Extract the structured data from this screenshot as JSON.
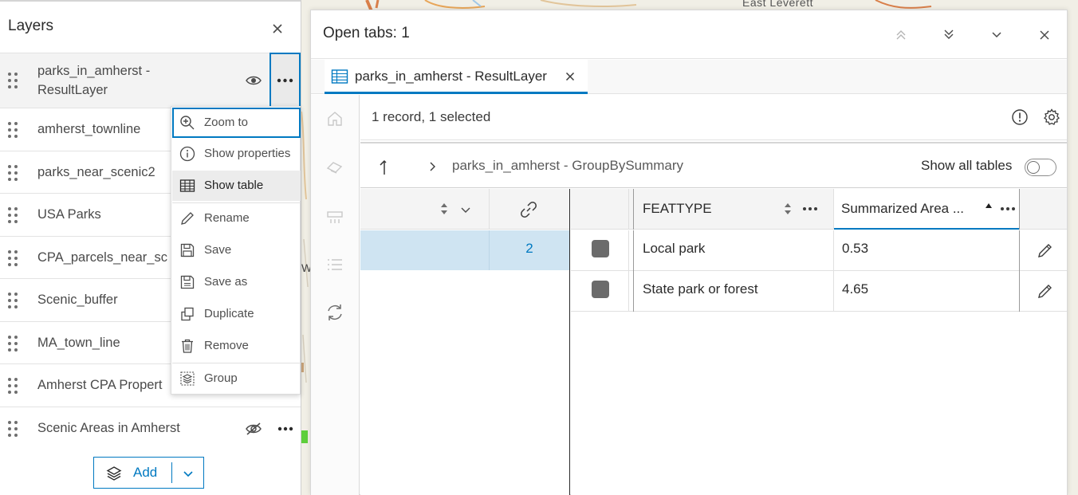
{
  "layers_panel": {
    "title": "Layers",
    "items": [
      {
        "label_line1": "parks_in_amherst -",
        "label_line2": "ResultLayer",
        "visible": true
      },
      {
        "label": "amherst_townline"
      },
      {
        "label": "parks_near_scenic2"
      },
      {
        "label": "USA Parks"
      },
      {
        "label": "CPA_parcels_near_sc"
      },
      {
        "label": "Scenic_buffer"
      },
      {
        "label": "MA_town_line"
      },
      {
        "label": "Amherst CPA Propert"
      },
      {
        "label": "Scenic Areas in Amherst",
        "visible": false
      }
    ],
    "add_label": "Add"
  },
  "context_menu": {
    "items": [
      {
        "label": "Zoom to",
        "icon": "zoom-in-icon"
      },
      {
        "label": "Show properties",
        "icon": "info-icon"
      },
      {
        "label": "Show table",
        "icon": "table-icon"
      },
      {
        "label": "Rename",
        "icon": "pencil-icon"
      },
      {
        "label": "Save",
        "icon": "save-icon"
      },
      {
        "label": "Save as",
        "icon": "save-as-icon"
      },
      {
        "label": "Duplicate",
        "icon": "duplicate-icon"
      },
      {
        "label": "Remove",
        "icon": "trash-icon"
      },
      {
        "label": "Group",
        "icon": "group-icon"
      }
    ]
  },
  "map": {
    "place_label": "East Leverett"
  },
  "table_dialog": {
    "title": "Open tabs: 1",
    "tab_label": "parks_in_amherst - ResultLayer",
    "records_text": "1 record, 1 selected",
    "breadcrumb": "parks_in_amherst - GroupBySummary",
    "show_all_tables": "Show all tables",
    "show_all_tables_on": false,
    "related_count": "2",
    "columns": {
      "feattype": "FEATTYPE",
      "area": "Summarized Area ..."
    },
    "rows": [
      {
        "feattype": "Local park",
        "area": "0.53"
      },
      {
        "feattype": "State park or forest",
        "area": "4.65"
      }
    ]
  },
  "colors": {
    "accent": "#0079c1",
    "selected_row": "#cfe4f2",
    "checkbox": "#6b6b6b"
  }
}
